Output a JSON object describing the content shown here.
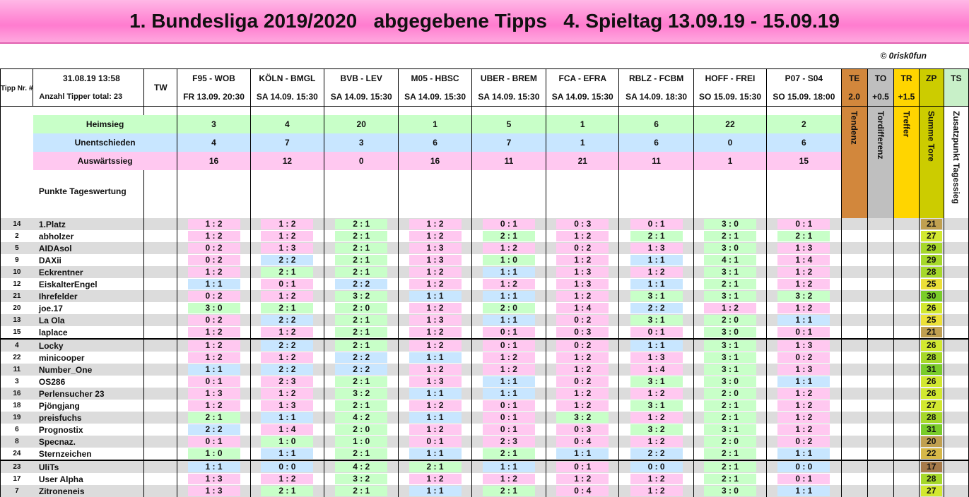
{
  "header": {
    "title": "1. Bundesliga 2019/2020   abgegebene Tipps   4. Spieltag 13.09.19 - 15.09.19",
    "copyright": "© 0risk0fun",
    "tipp_nr": "Tipp Nr. #",
    "timestamp": "31.08.19   13:58",
    "anzahl": "Anzahl Tipper total:  23",
    "tw": "TW"
  },
  "matches": [
    {
      "name": "F95 - WOB",
      "date": "FR 13.09. 20:30",
      "h": "3",
      "u": "4",
      "a": "16"
    },
    {
      "name": "KÖLN - BMGL",
      "date": "SA 14.09. 15:30",
      "h": "4",
      "u": "7",
      "a": "12"
    },
    {
      "name": "BVB - LEV",
      "date": "SA 14.09. 15:30",
      "h": "20",
      "u": "3",
      "a": "0"
    },
    {
      "name": "M05 - HBSC",
      "date": "SA 14.09. 15:30",
      "h": "1",
      "u": "6",
      "a": "16"
    },
    {
      "name": "UBER - BREM",
      "date": "SA 14.09. 15:30",
      "h": "5",
      "u": "7",
      "a": "11"
    },
    {
      "name": "FCA - EFRA",
      "date": "SA 14.09. 15:30",
      "h": "1",
      "u": "1",
      "a": "21"
    },
    {
      "name": "RBLZ - FCBM",
      "date": "SA 14.09. 18:30",
      "h": "6",
      "u": "6",
      "a": "11"
    },
    {
      "name": "HOFF - FREI",
      "date": "SO 15.09. 15:30",
      "h": "22",
      "u": "0",
      "a": "1"
    },
    {
      "name": "P07 - S04",
      "date": "SO 15.09. 18:00",
      "h": "2",
      "u": "6",
      "a": "15"
    }
  ],
  "extra_cols": [
    {
      "code": "TE",
      "value": "2.0",
      "label": "Tendenz",
      "color": "#d2873c"
    },
    {
      "code": "TO",
      "value": "+0.5",
      "label": "Tordifferenz",
      "color": "#bfbfbf"
    },
    {
      "code": "TR",
      "value": "+1.5",
      "label": "Treffer",
      "color": "#ffd500"
    },
    {
      "code": "ZP",
      "value": "",
      "label": "Summe Tore",
      "color": "#cccc00"
    },
    {
      "code": "TS",
      "value": "",
      "label": "Zusatzpunkt Tagessieg",
      "color": "#c8f0c8"
    }
  ],
  "stats_labels": {
    "heim": "Heimsieg",
    "unent": "Unentschieden",
    "aus": "Auswärtssieg",
    "punkte": "Punkte Tageswertung"
  },
  "colors": {
    "home": "#ffc8f0",
    "draw": "#c8e6ff",
    "away": "#c8ffc8",
    "row_grey": "#dcdcdc",
    "banner": "#ff8ed6"
  },
  "players": [
    {
      "nr": "14",
      "name": "1.Platz",
      "tips": [
        "1 : 2",
        "1 : 2",
        "2 : 1",
        "1 : 2",
        "0 : 1",
        "0 : 3",
        "0 : 1",
        "3 : 0",
        "0 : 1"
      ],
      "zp": "21"
    },
    {
      "nr": "2",
      "name": "abholzer",
      "tips": [
        "1 : 2",
        "1 : 2",
        "2 : 1",
        "1 : 2",
        "2 : 1",
        "1 : 2",
        "2 : 1",
        "2 : 1",
        "2 : 1"
      ],
      "zp": "27"
    },
    {
      "nr": "5",
      "name": "AIDAsol",
      "tips": [
        "0 : 2",
        "1 : 3",
        "2 : 1",
        "1 : 3",
        "1 : 2",
        "0 : 2",
        "1 : 3",
        "3 : 0",
        "1 : 3"
      ],
      "zp": "29"
    },
    {
      "nr": "9",
      "name": "DAXii",
      "tips": [
        "0 : 2",
        "2 : 2",
        "2 : 1",
        "1 : 3",
        "1 : 0",
        "1 : 2",
        "1 : 1",
        "4 : 1",
        "1 : 4"
      ],
      "zp": "29"
    },
    {
      "nr": "10",
      "name": "Eckrentner",
      "tips": [
        "1 : 2",
        "2 : 1",
        "2 : 1",
        "1 : 2",
        "1 : 1",
        "1 : 3",
        "1 : 2",
        "3 : 1",
        "1 : 2"
      ],
      "zp": "28"
    },
    {
      "nr": "12",
      "name": "EiskalterEngel",
      "tips": [
        "1 : 1",
        "0 : 1",
        "2 : 2",
        "1 : 2",
        "1 : 2",
        "1 : 3",
        "1 : 1",
        "2 : 1",
        "1 : 2"
      ],
      "zp": "25"
    },
    {
      "nr": "21",
      "name": "Ihrefelder",
      "tips": [
        "0 : 2",
        "1 : 2",
        "3 : 2",
        "1 : 1",
        "1 : 1",
        "1 : 2",
        "3 : 1",
        "3 : 1",
        "3 : 2"
      ],
      "zp": "30"
    },
    {
      "nr": "20",
      "name": "joe.17",
      "tips": [
        "3 : 0",
        "2 : 1",
        "2 : 0",
        "1 : 2",
        "2 : 0",
        "1 : 4",
        "2 : 2",
        "1 : 2",
        "1 : 2"
      ],
      "zp": "26"
    },
    {
      "nr": "13",
      "name": "La Ola",
      "tips": [
        "0 : 2",
        "2 : 2",
        "2 : 1",
        "1 : 3",
        "1 : 1",
        "0 : 2",
        "3 : 1",
        "2 : 0",
        "1 : 1"
      ],
      "zp": "25"
    },
    {
      "nr": "15",
      "name": "laplace",
      "tips": [
        "1 : 2",
        "1 : 2",
        "2 : 1",
        "1 : 2",
        "0 : 1",
        "0 : 3",
        "0 : 1",
        "3 : 0",
        "0 : 1"
      ],
      "zp": "21"
    },
    {
      "nr": "4",
      "name": "Locky",
      "tips": [
        "1 : 2",
        "2 : 2",
        "2 : 1",
        "1 : 2",
        "0 : 1",
        "0 : 2",
        "1 : 1",
        "3 : 1",
        "1 : 3"
      ],
      "zp": "26"
    },
    {
      "nr": "22",
      "name": "minicooper",
      "tips": [
        "1 : 2",
        "1 : 2",
        "2 : 2",
        "1 : 1",
        "1 : 2",
        "1 : 2",
        "1 : 3",
        "3 : 1",
        "0 : 2"
      ],
      "zp": "28"
    },
    {
      "nr": "11",
      "name": "Number_One",
      "tips": [
        "1 : 1",
        "2 : 2",
        "2 : 2",
        "1 : 2",
        "1 : 2",
        "1 : 2",
        "1 : 4",
        "3 : 1",
        "1 : 3"
      ],
      "zp": "31"
    },
    {
      "nr": "3",
      "name": "OS286",
      "tips": [
        "0 : 1",
        "2 : 3",
        "2 : 1",
        "1 : 3",
        "1 : 1",
        "0 : 2",
        "3 : 1",
        "3 : 0",
        "1 : 1"
      ],
      "zp": "26"
    },
    {
      "nr": "16",
      "name": "Perlensucher 23",
      "tips": [
        "1 : 3",
        "1 : 2",
        "3 : 2",
        "1 : 1",
        "1 : 1",
        "1 : 2",
        "1 : 2",
        "2 : 0",
        "1 : 2"
      ],
      "zp": "26"
    },
    {
      "nr": "18",
      "name": "Pjöngjang",
      "tips": [
        "1 : 2",
        "1 : 3",
        "2 : 1",
        "1 : 2",
        "0 : 1",
        "1 : 2",
        "3 : 1",
        "2 : 1",
        "1 : 2"
      ],
      "zp": "27"
    },
    {
      "nr": "19",
      "name": "preisfuchs",
      "tips": [
        "2 : 1",
        "1 : 1",
        "4 : 2",
        "1 : 1",
        "0 : 1",
        "3 : 2",
        "1 : 2",
        "2 : 1",
        "1 : 2"
      ],
      "zp": "28"
    },
    {
      "nr": "6",
      "name": "Prognostix",
      "tips": [
        "2 : 2",
        "1 : 4",
        "2 : 0",
        "1 : 2",
        "0 : 1",
        "0 : 3",
        "3 : 2",
        "3 : 1",
        "1 : 2"
      ],
      "zp": "31"
    },
    {
      "nr": "8",
      "name": "Specnaz.",
      "tips": [
        "0 : 1",
        "1 : 0",
        "1 : 0",
        "0 : 1",
        "2 : 3",
        "0 : 4",
        "1 : 2",
        "2 : 0",
        "0 : 2"
      ],
      "zp": "20"
    },
    {
      "nr": "24",
      "name": "Sternzeichen",
      "tips": [
        "1 : 0",
        "1 : 1",
        "2 : 1",
        "1 : 1",
        "2 : 1",
        "1 : 1",
        "2 : 2",
        "2 : 1",
        "1 : 1"
      ],
      "zp": "22"
    },
    {
      "nr": "23",
      "name": "UliTs",
      "tips": [
        "1 : 1",
        "0 : 0",
        "4 : 2",
        "2 : 1",
        "1 : 1",
        "0 : 1",
        "0 : 0",
        "2 : 1",
        "0 : 0"
      ],
      "zp": "17"
    },
    {
      "nr": "17",
      "name": "User Alpha",
      "tips": [
        "1 : 3",
        "1 : 2",
        "3 : 2",
        "1 : 2",
        "1 : 2",
        "1 : 2",
        "1 : 2",
        "2 : 1",
        "0 : 1"
      ],
      "zp": "28"
    },
    {
      "nr": "7",
      "name": "Zitroneneis",
      "tips": [
        "1 : 3",
        "2 : 1",
        "2 : 1",
        "1 : 1",
        "2 : 1",
        "0 : 4",
        "1 : 2",
        "3 : 0",
        "1 : 1"
      ],
      "zp": "27"
    }
  ]
}
